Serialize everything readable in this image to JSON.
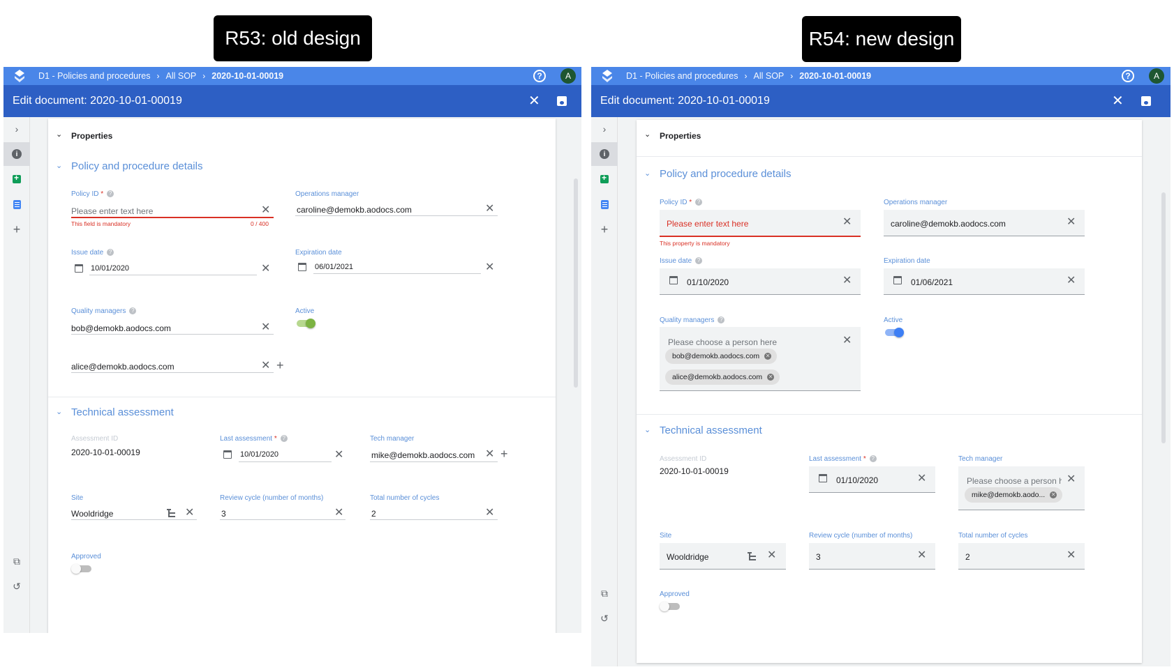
{
  "captions": {
    "left": "R53: old design",
    "right": "R54: new design"
  },
  "breadcrumb": {
    "root": "D1 - Policies and procedures",
    "middle": "All SOP",
    "current": "2020-10-01-00019"
  },
  "header": {
    "title": "Edit document: 2020-10-01-00019",
    "avatar_letter": "A",
    "help_glyph": "?"
  },
  "properties_label": "Properties",
  "sections": {
    "policy": "Policy and procedure details",
    "technical": "Technical assessment"
  },
  "fields": {
    "policy_id": {
      "label": "Policy ID",
      "required": "*",
      "placeholder": "Please enter text here",
      "counter": "0 / 400"
    },
    "operations_manager": {
      "label": "Operations manager",
      "value": "caroline@demokb.aodocs.com"
    },
    "issue_date": {
      "label": "Issue date"
    },
    "expiration_date": {
      "label": "Expiration date"
    },
    "quality_managers": {
      "label": "Quality managers",
      "placeholder": "Please choose a person here",
      "value1": "bob@demokb.aodocs.com",
      "value2": "alice@demokb.aodocs.com"
    },
    "active": {
      "label": "Active",
      "on": true
    },
    "assessment_id": {
      "label": "Assessment ID",
      "value": "2020-10-01-00019"
    },
    "last_assessment": {
      "label": "Last assessment",
      "required": "*"
    },
    "tech_manager": {
      "label": "Tech manager",
      "value": "mike@demokb.aodocs.com",
      "chip": "mike@demokb.aodo...",
      "placeholder": "Please choose a person h"
    },
    "site": {
      "label": "Site",
      "value": "Wooldridge"
    },
    "review_cycle": {
      "label": "Review cycle (number of months)",
      "value": "3"
    },
    "total_cycles": {
      "label": "Total number of cycles",
      "value": "2"
    },
    "approved": {
      "label": "Approved",
      "on": false
    }
  },
  "old": {
    "mandatory_msg": "This field is mandatory",
    "issue_date": "10/01/2020",
    "expiration_date": "06/01/2021",
    "last_assessment": "10/01/2020"
  },
  "new": {
    "mandatory_msg": "This property is mandatory",
    "issue_date": "01/10/2020",
    "expiration_date": "01/06/2021",
    "last_assessment": "01/10/2020"
  },
  "icons": [
    "logo-icon",
    "help-icon",
    "close-icon",
    "save-icon",
    "chevron-right-icon",
    "info-icon",
    "sheets-icon",
    "docs-icon",
    "plus-icon",
    "copy-icon",
    "history-icon",
    "calendar-icon",
    "tree-icon",
    "chip-remove-icon",
    "chevron-down-icon"
  ],
  "colors": {
    "topbar": "#4a86e8",
    "editbar": "#2d5fc4",
    "label": "#5a8fd8",
    "error": "#d93025",
    "toggle_old_on": "#7cb342",
    "toggle_new_on": "#3d7ff5"
  }
}
